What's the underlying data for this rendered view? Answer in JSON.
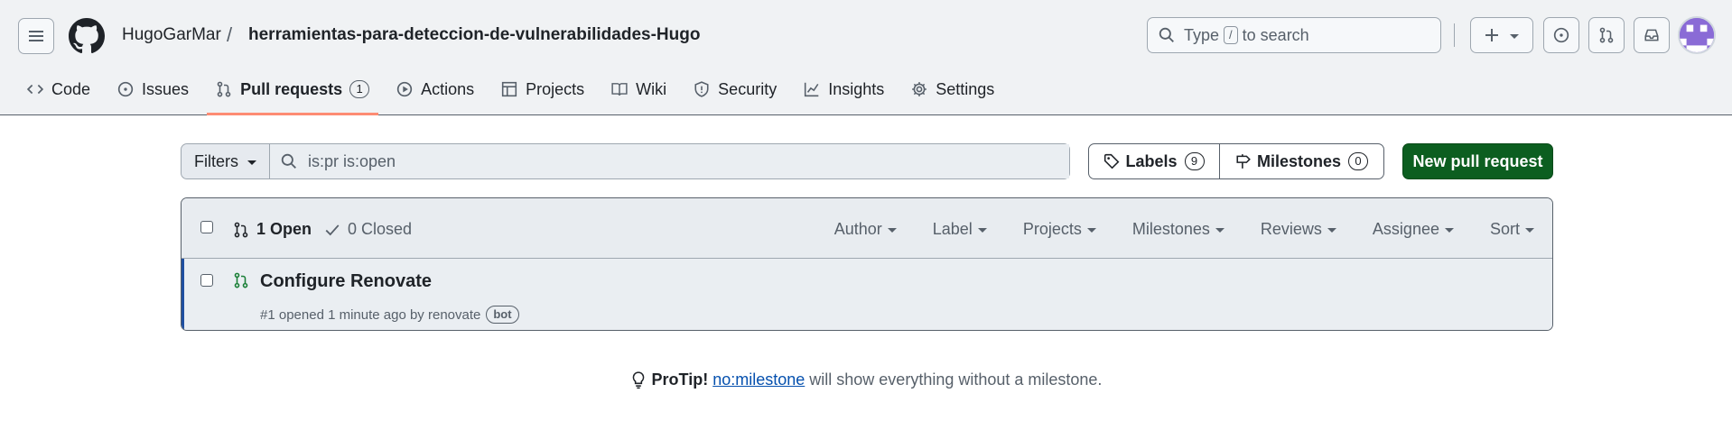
{
  "header": {
    "owner": "HugoGarMar",
    "separator": "/",
    "repo": "herramientas-para-deteccion-de-vulnerabilidades-Hugo",
    "search_type": "Type",
    "search_key": "/",
    "search_rest": "to search"
  },
  "tabs": [
    {
      "label": "Code",
      "icon": "code-icon"
    },
    {
      "label": "Issues",
      "icon": "issue-icon"
    },
    {
      "label": "Pull requests",
      "icon": "pull-request-icon",
      "count": "1",
      "active": true
    },
    {
      "label": "Actions",
      "icon": "play-icon"
    },
    {
      "label": "Projects",
      "icon": "table-icon"
    },
    {
      "label": "Wiki",
      "icon": "book-icon"
    },
    {
      "label": "Security",
      "icon": "shield-icon"
    },
    {
      "label": "Insights",
      "icon": "graph-icon"
    },
    {
      "label": "Settings",
      "icon": "gear-icon"
    }
  ],
  "toolbar": {
    "filters_label": "Filters",
    "filter_query": "is:pr is:open",
    "labels_label": "Labels",
    "labels_count": "9",
    "milestones_label": "Milestones",
    "milestones_count": "0",
    "new_pr_label": "New pull request"
  },
  "list": {
    "open_label": "1 Open",
    "closed_label": "0 Closed",
    "filters": [
      "Author",
      "Label",
      "Projects",
      "Milestones",
      "Reviews",
      "Assignee",
      "Sort"
    ],
    "items": [
      {
        "title": "Configure Renovate",
        "meta": "#1 opened 1 minute ago by renovate",
        "badge": "bot"
      }
    ]
  },
  "protip": {
    "prefix": "ProTip!",
    "link": "no:milestone",
    "suffix": "will show everything without a milestone."
  },
  "colors": {
    "accent_underline": "#fd8c73",
    "primary_button": "#0c5e20",
    "open_icon": "#1a7f37",
    "link": "#0550ae"
  }
}
